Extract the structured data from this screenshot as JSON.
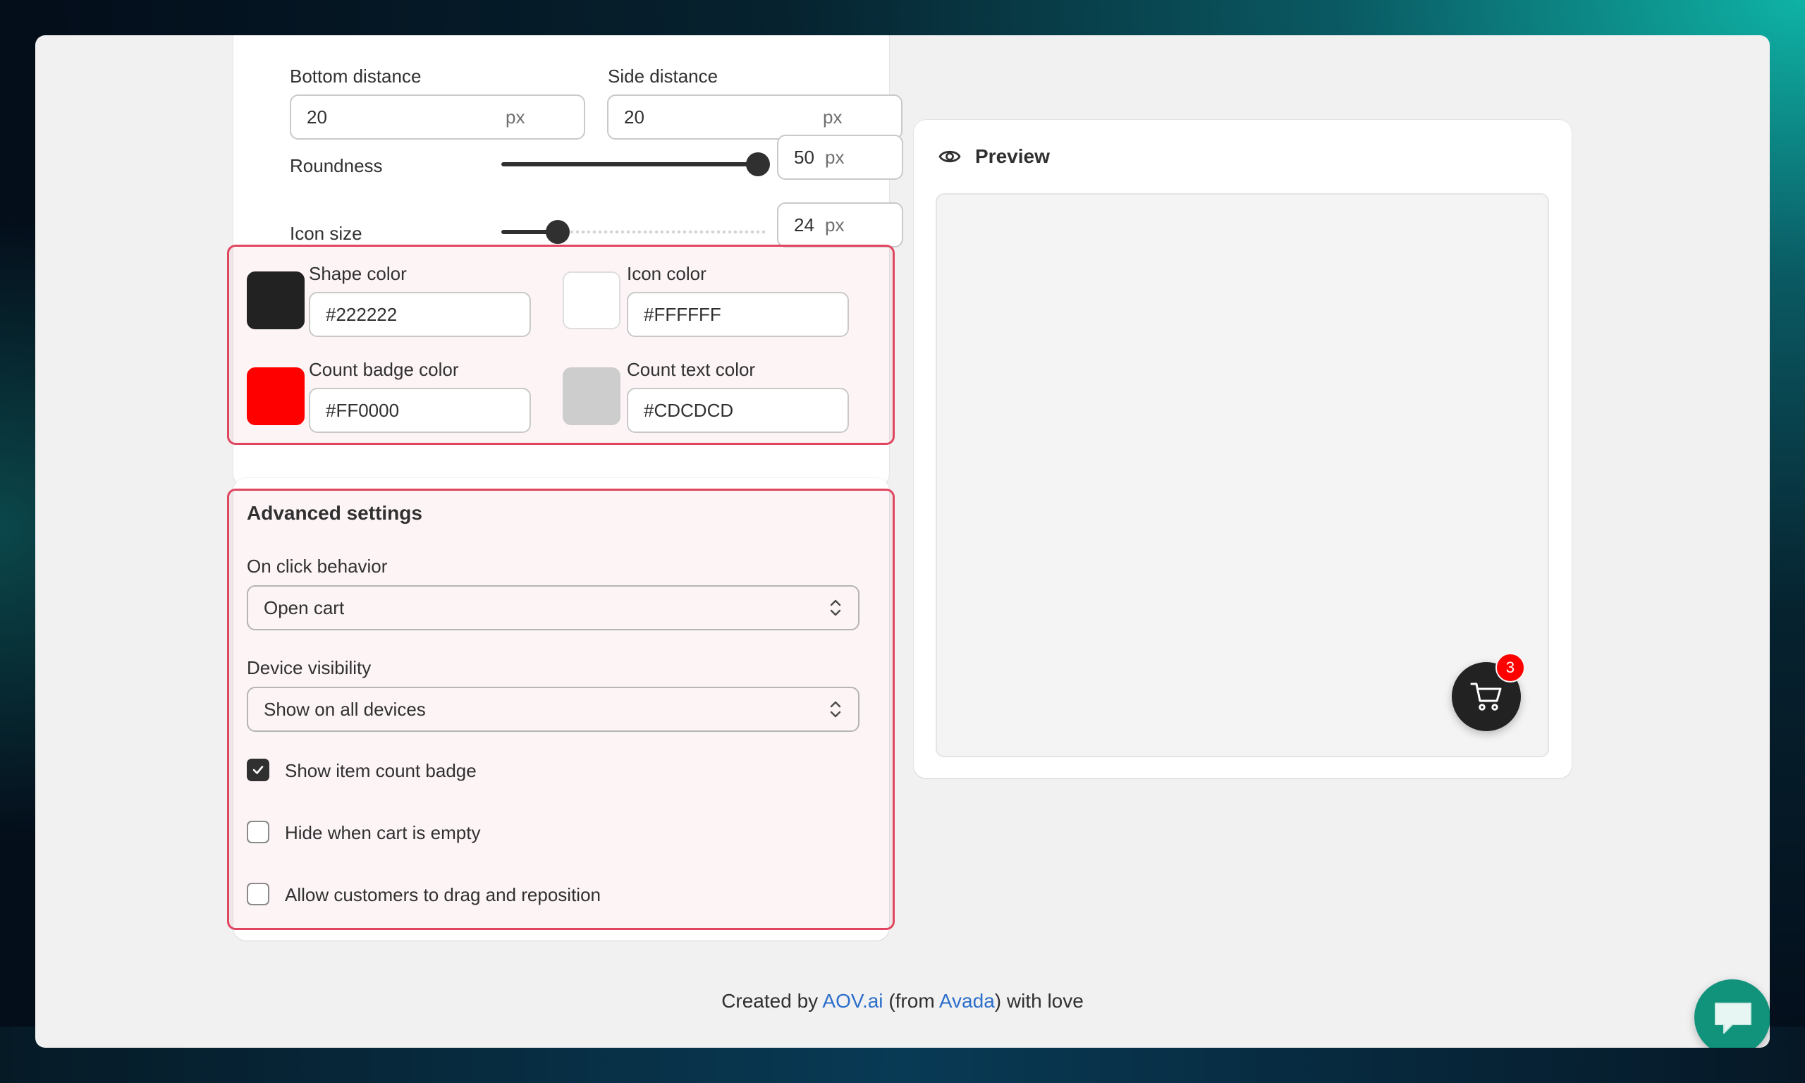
{
  "position": {
    "bottom_distance_label": "Bottom distance",
    "bottom_distance_value": "20",
    "side_distance_label": "Side distance",
    "side_distance_value": "20",
    "unit": "px"
  },
  "roundness": {
    "label": "Roundness",
    "value": "50",
    "unit": "px",
    "level": 1.0
  },
  "icon_size": {
    "label": "Icon size",
    "value": "24",
    "unit": "px",
    "level": 0.21
  },
  "colors": {
    "shape": {
      "label": "Shape color",
      "value": "#222222",
      "swatch": "#222222"
    },
    "icon": {
      "label": "Icon color",
      "value": "#FFFFFF",
      "swatch": "#FFFFFF"
    },
    "badge": {
      "label": "Count badge color",
      "value": "#FF0000",
      "swatch": "#FF0000"
    },
    "text": {
      "label": "Count text color",
      "value": "#CDCDCD",
      "swatch": "#CDCDCD"
    }
  },
  "advanced": {
    "title": "Advanced settings",
    "click_label": "On click behavior",
    "click_value": "Open cart",
    "visibility_label": "Device visibility",
    "visibility_value": "Show on all devices",
    "checkboxes": [
      {
        "label": "Show item count badge",
        "checked": true
      },
      {
        "label": "Hide when cart is empty",
        "checked": false
      },
      {
        "label": "Allow customers to drag and reposition",
        "checked": false
      }
    ]
  },
  "preview": {
    "title": "Preview",
    "badge_count": "3"
  },
  "footer": {
    "prefix": "Created by",
    "link1": "AOV.ai",
    "middle": "(from",
    "link2": "Avada",
    "suffix": ") with love"
  },
  "highlight_color": "#e0475f"
}
